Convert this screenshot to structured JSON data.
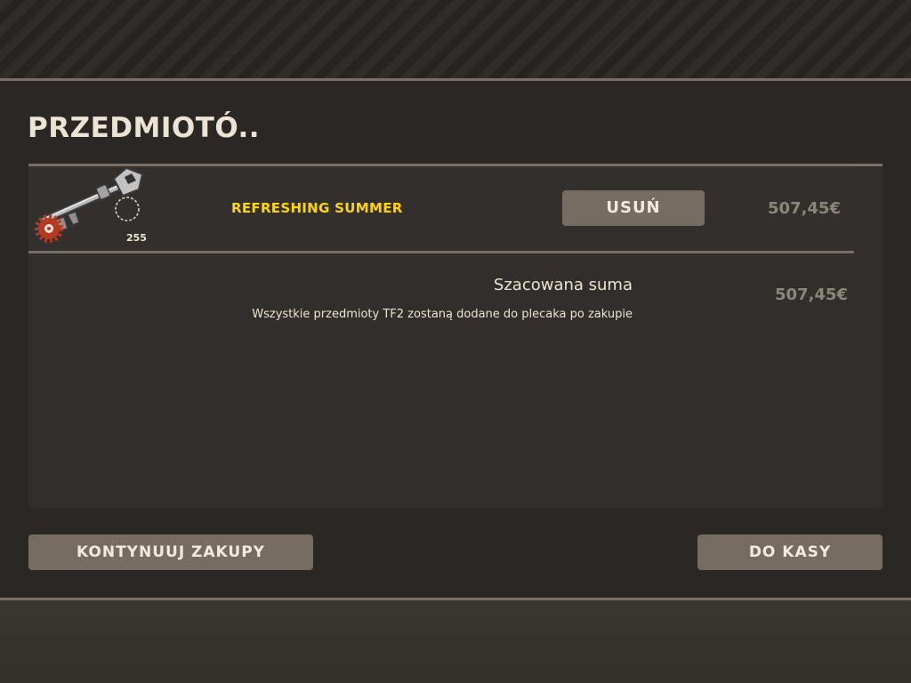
{
  "dialog": {
    "title": "PRZEDMIOTÓ.."
  },
  "cart": {
    "items": [
      {
        "icon": "key-icon",
        "quantity": "255",
        "name": "REFRESHING SUMMER",
        "name_color": "#ffd700",
        "remove_label": "USUŃ",
        "price": "507,45€"
      }
    ],
    "summary": {
      "label": "Szacowana suma",
      "note": "Wszystkie przedmioty TF2 zostaną dodane do plecaka po zakupie",
      "total": "507,45€"
    }
  },
  "footer": {
    "continue_label": "KONTYNUUJ ZAKUPY",
    "checkout_label": "DO KASY"
  }
}
